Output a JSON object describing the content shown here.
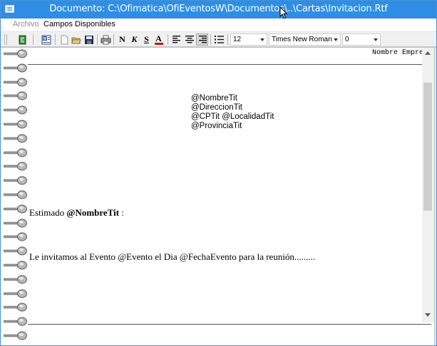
{
  "window": {
    "title": "Documento: C:\\Ofimatica\\OfiEventosW\\Documentos\\..\\Cartas\\Invitacion.Rtf"
  },
  "menu": {
    "items": [
      {
        "label": "Archivo",
        "enabled": false
      },
      {
        "label": "Campos Disponibles",
        "enabled": true
      }
    ]
  },
  "toolbar": {
    "bold_label": "N",
    "italic_label": "K",
    "underline_label": "S",
    "color_label": "A",
    "font_size": "12",
    "font_name": "Times New Roman",
    "third_value": "0"
  },
  "document": {
    "header_text": "Nombre Empresa",
    "address_lines": [
      "@NombreTit",
      "@DireccionTit",
      "@CPTit @LocalidadTit",
      "@ProvinciaTit"
    ],
    "greeting_prefix": "Estimado ",
    "greeting_field": "@NombreTit",
    "greeting_suffix": " :",
    "invitation_text": "Le invitamos al Evento @Evento  el Dia @FechaEvento  para la reunión........."
  },
  "colors": {
    "titlebar": "#2f8ee3",
    "font_color_swatch": "#d01010"
  }
}
